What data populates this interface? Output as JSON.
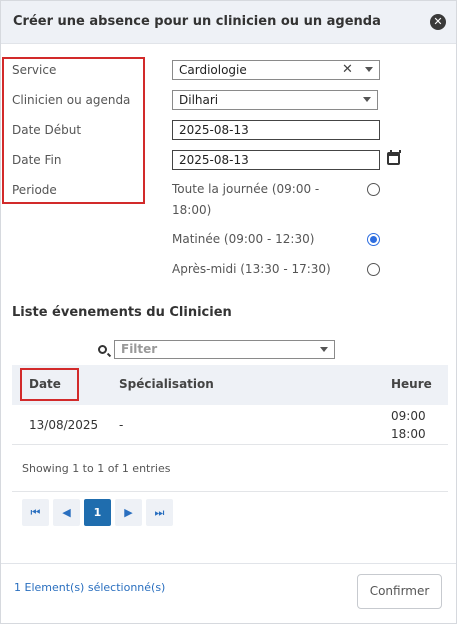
{
  "dialog": {
    "title": "Créer une absence pour un clinicien ou un agenda",
    "close_icon": "close-icon"
  },
  "form": {
    "service_label": "Service",
    "service_value": "Cardiologie",
    "clinicien_label": "Clinicien ou agenda",
    "clinicien_value": "Dilhari",
    "date_debut_label": "Date Début",
    "date_debut_value": "2025-08-13",
    "date_fin_label": "Date Fin",
    "date_fin_value": "2025-08-13",
    "periode_label": "Periode",
    "periode_options": [
      {
        "line1": "Toute la journée (09:00 -",
        "line2": "18:00)",
        "selected": false
      },
      {
        "line1": "Matinée (09:00 - 12:30)",
        "selected": true
      },
      {
        "line1": "Après-midi (13:30 - 17:30)",
        "selected": false
      }
    ]
  },
  "events": {
    "title": "Liste évenements du Clinicien",
    "filter_placeholder": "Filter",
    "columns": [
      "Date",
      "Spécialisation",
      "Heure"
    ],
    "rows": [
      {
        "date": "13/08/2025",
        "specialisation": "-",
        "heure_start": "09:00",
        "heure_end": "18:00"
      }
    ],
    "showing": "Showing 1 to 1 of 1 entries",
    "pagination": {
      "first": "⏮",
      "prev": "◀",
      "current": "1",
      "next": "▶",
      "last": "⏭"
    }
  },
  "footer": {
    "selected_count": "1 Element(s) sélectionné(s)",
    "confirm_label": "Confirmer"
  },
  "colors": {
    "highlight_red": "#d22a2a",
    "accent_blue": "#1f6dae",
    "header_bg": "#eef1f6"
  }
}
